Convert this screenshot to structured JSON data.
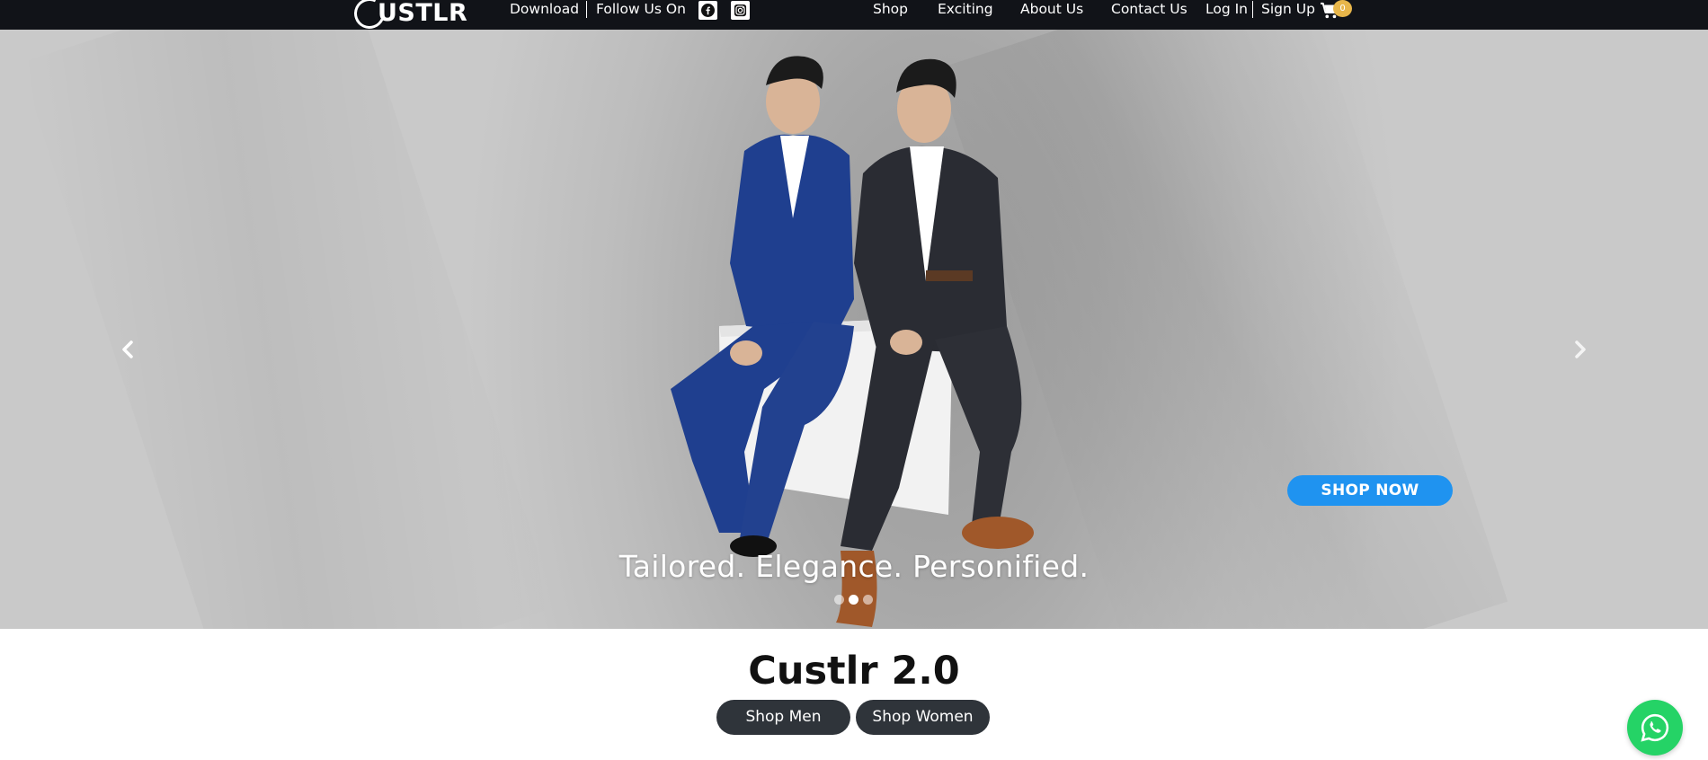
{
  "header": {
    "logo_text": "USTLR",
    "nav_left": {
      "download": "Download",
      "follow": "Follow Us On"
    },
    "social_icons": [
      "facebook-icon",
      "instagram-icon"
    ],
    "nav_right": {
      "shop": "Shop",
      "exciting": "Exciting",
      "about": "About Us",
      "contact": "Contact Us",
      "login": "Log In",
      "signup": "Sign Up"
    },
    "cart_count": "0"
  },
  "hero": {
    "tagline": "Tailored. Elegance. Personified.",
    "cta_label": "SHOP NOW",
    "slides_total": 3,
    "active_slide": 2,
    "image_alt": "Two men in tailored suits sitting on a white block"
  },
  "section": {
    "title": "Custlr 2.0",
    "buttons": [
      "Shop Men",
      "Shop Women"
    ]
  },
  "colors": {
    "topbar": "#111318",
    "cta": "#1f93f0",
    "pill": "#2f343a",
    "whatsapp": "#25d366",
    "badge": "#e8b64a"
  }
}
